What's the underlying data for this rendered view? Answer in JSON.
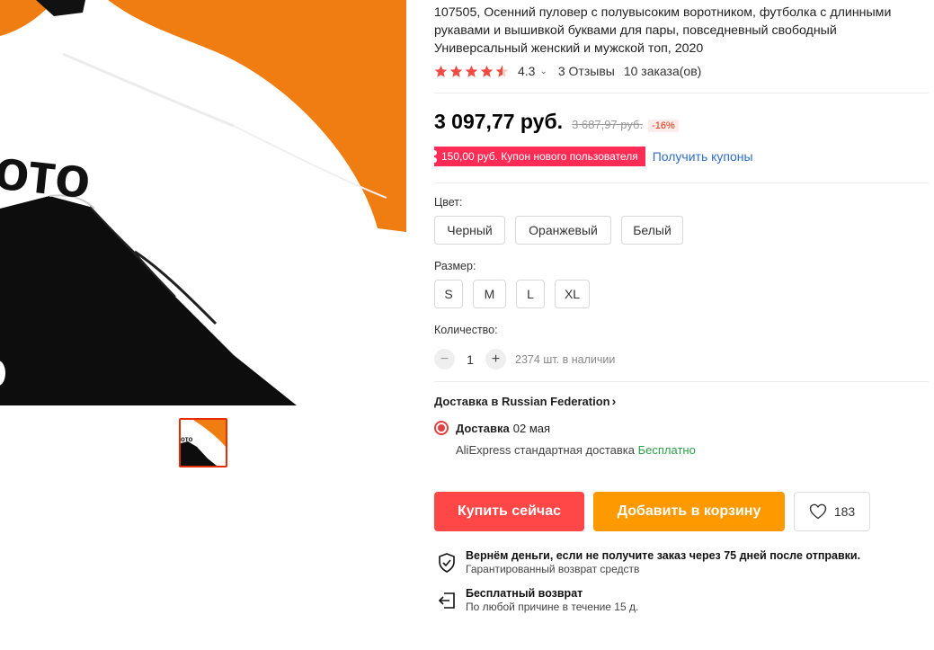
{
  "product": {
    "title": "107505, Осенний пуловер с полувысоким воротником, футболка с длинными рукавами и вышивкой буквами для пары, повседневный свободный Универсальный женский и мужской топ, 2020",
    "rating": "4.3",
    "rating_stars": 4.3,
    "reviews": "3 Отзывы",
    "orders": "10 заказа(ов)"
  },
  "price": {
    "current": "3 097,77 руб.",
    "old": "3 687,97 руб.",
    "discount": "-16%"
  },
  "coupon": {
    "badge": "150,00 руб. Купон нового пользователя",
    "link": "Получить купоны"
  },
  "color": {
    "label": "Цвет:",
    "options": [
      "Черный",
      "Оранжевый",
      "Белый"
    ]
  },
  "size": {
    "label": "Размер:",
    "options": [
      "S",
      "M",
      "L",
      "XL"
    ]
  },
  "quantity": {
    "label": "Количество:",
    "minus": "−",
    "value": "1",
    "plus": "+",
    "stock": "2374 шт. в наличии"
  },
  "shipping": {
    "title": "Доставка в Russian Federation",
    "option_label": "Доставка",
    "option_date": "02 мая",
    "carrier": "AliExpress стандартная доставка",
    "price": "Бесплатно"
  },
  "actions": {
    "buy": "Купить сейчас",
    "cart": "Добавить в корзину",
    "wishlist_count": "183"
  },
  "guarantees": [
    {
      "title": "Вернём деньги, если не получите заказ через 75 дней после отправки.",
      "subtitle": "Гарантированный возврат средств"
    },
    {
      "title": "Бесплатный возврат",
      "subtitle": "По любой причине в течение 15 д."
    }
  ],
  "colors": {
    "accent_red": "#ff4747",
    "accent_orange": "#ff9900",
    "link_blue": "#2e6ec9",
    "free_green": "#2aa14a",
    "star": "#f14b41"
  },
  "image": {
    "print_text": "ото"
  }
}
